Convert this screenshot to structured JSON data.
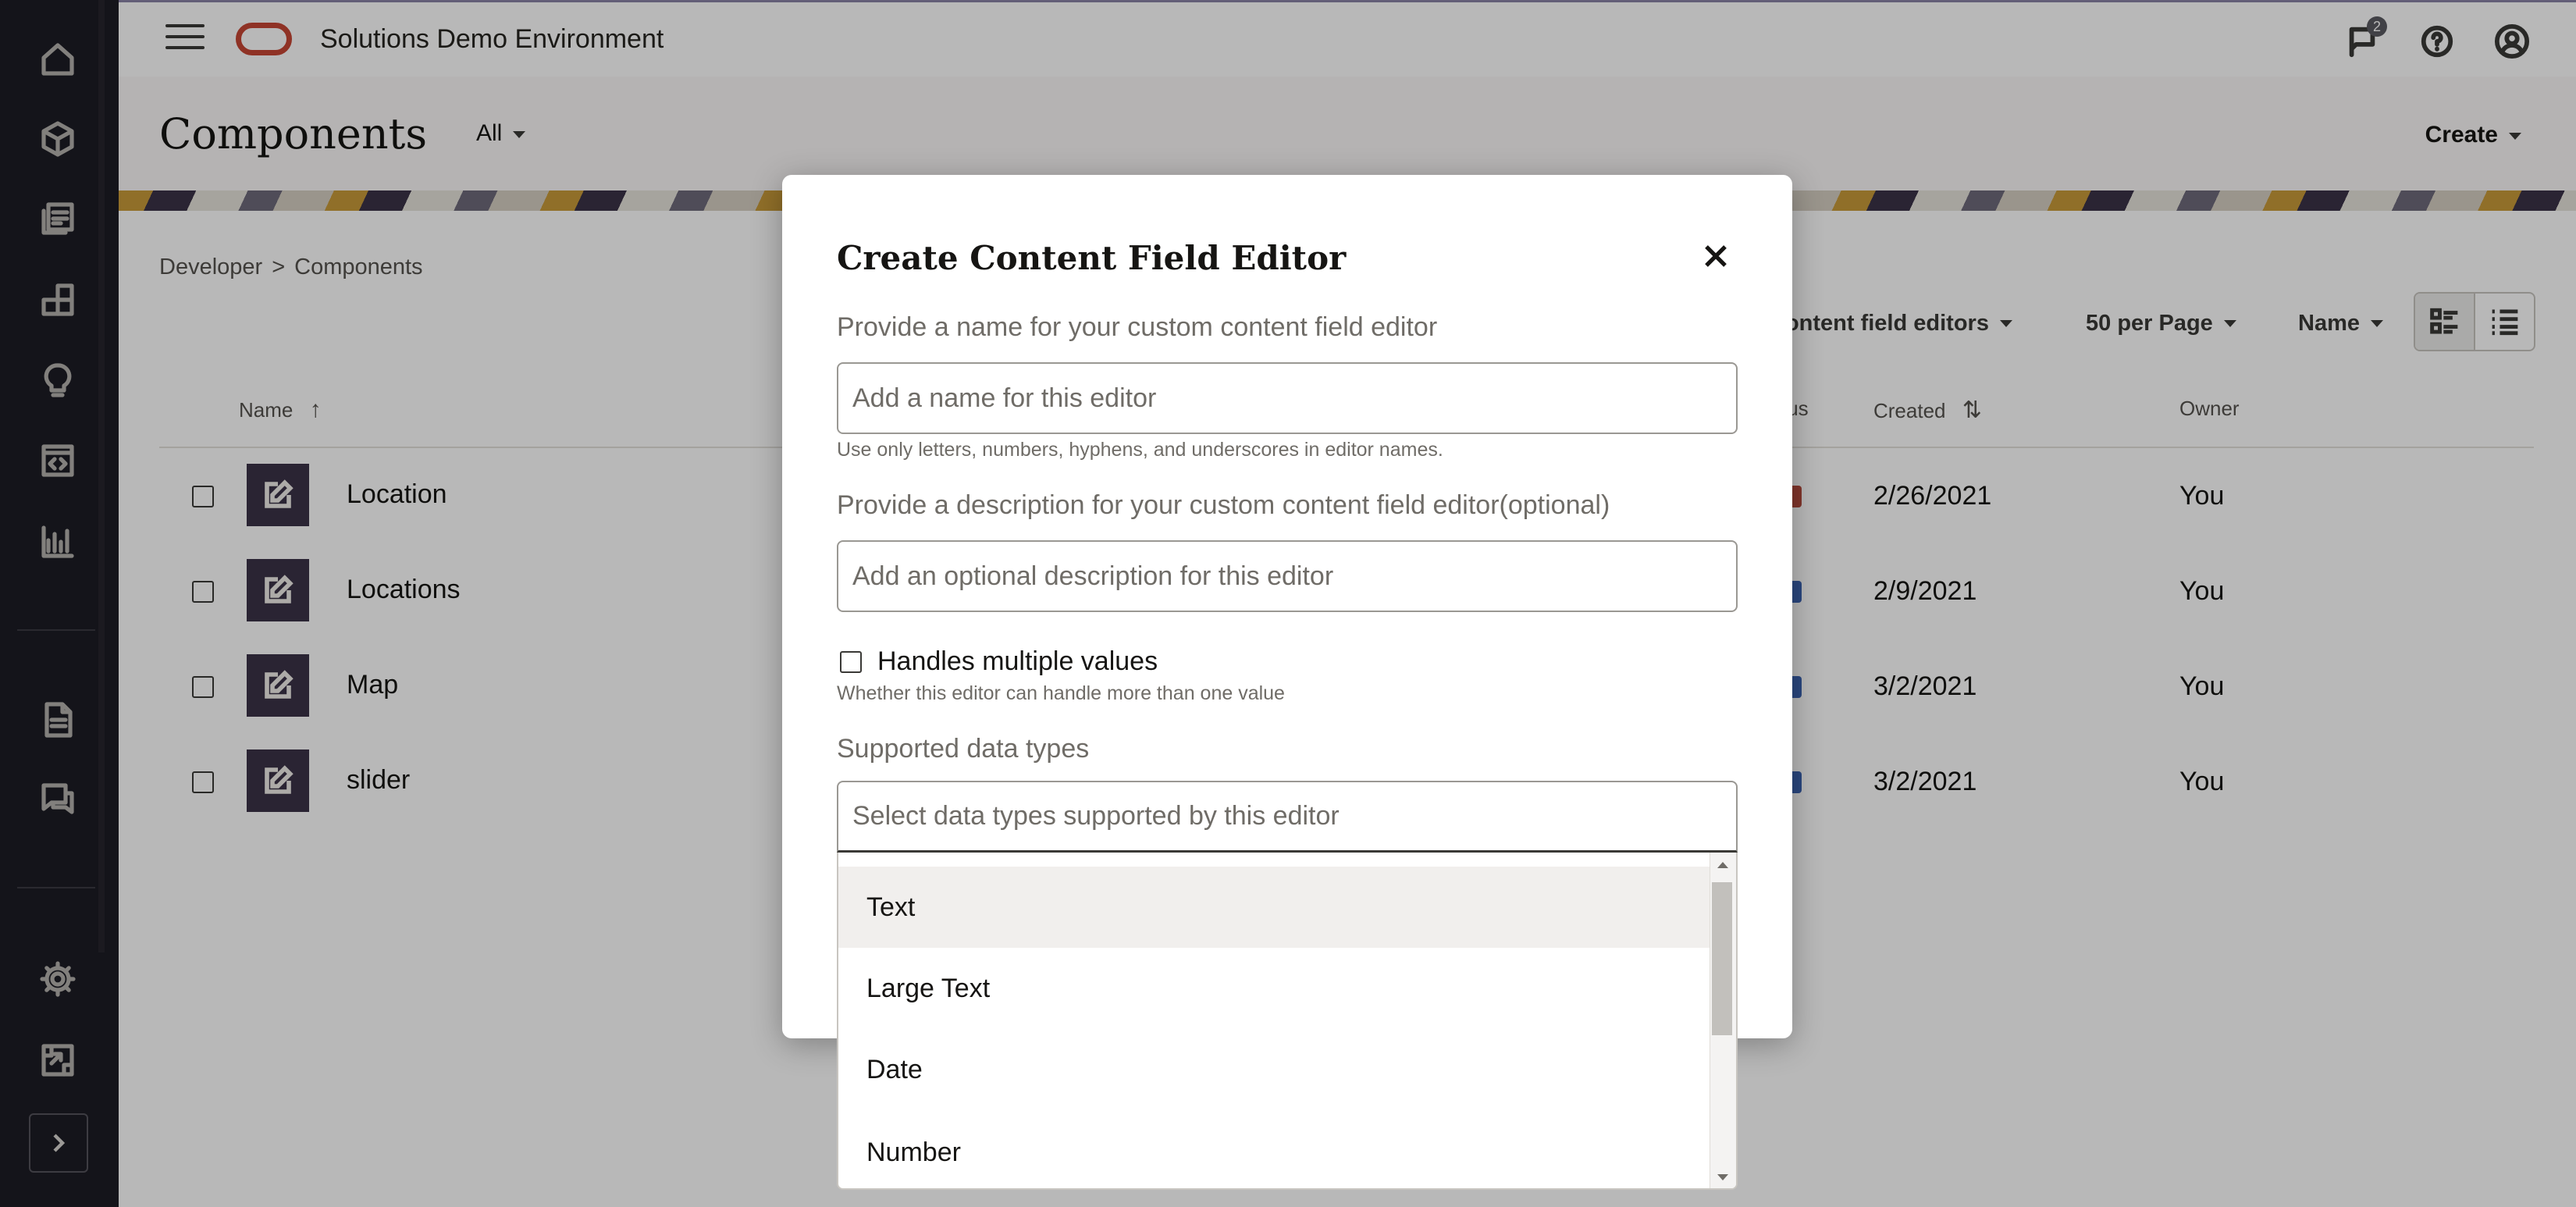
{
  "rail": {
    "icons": [
      "home-icon",
      "cube-icon",
      "assets-icon",
      "components-icon",
      "lightbulb-icon",
      "code-window-icon",
      "analytics-icon",
      "document-icon",
      "conversations-icon",
      "gear-icon",
      "integrations-icon",
      "expand-icon"
    ]
  },
  "topbar": {
    "app_title": "Solutions Demo Environment",
    "notifications_count": "2"
  },
  "page": {
    "title": "Components",
    "scope_filter": "All",
    "create_label": "Create"
  },
  "breadcrumb": [
    "Developer",
    ">",
    "Components"
  ],
  "filters": {
    "type": "Content field editors",
    "per_page": "50 per Page",
    "sort": "Name"
  },
  "table": {
    "headers": {
      "name": "Name",
      "status": "tus",
      "created": "Created",
      "owner": "Owner"
    },
    "rows": [
      {
        "name": "Location",
        "created": "2/26/2021",
        "owner": "You"
      },
      {
        "name": "Locations",
        "created": "2/9/2021",
        "owner": "You"
      },
      {
        "name": "Map",
        "created": "3/2/2021",
        "owner": "You"
      },
      {
        "name": "slider",
        "created": "3/2/2021",
        "owner": "You"
      }
    ]
  },
  "modal": {
    "title": "Create Content Field Editor",
    "name_label": "Provide a name for your custom content field editor",
    "name_placeholder": "Add a name for this editor",
    "name_hint": "Use only letters, numbers, hyphens, and underscores in editor names.",
    "description_label": "Provide a description for your custom content field editor(optional)",
    "description_placeholder": "Add an optional description for this editor",
    "multiple_label": "Handles multiple values",
    "multiple_hint": "Whether this editor can handle more than one value",
    "types_label": "Supported data types",
    "types_placeholder": "Select data types supported by this editor",
    "type_options": [
      "Text",
      "Large Text",
      "Date",
      "Number"
    ]
  },
  "colors": {
    "rail_bg": "#1c1c24",
    "oracle_red": "#c74634",
    "thumb_bg": "#3b3347",
    "overlay": "rgba(0,0,0,0.28)"
  }
}
